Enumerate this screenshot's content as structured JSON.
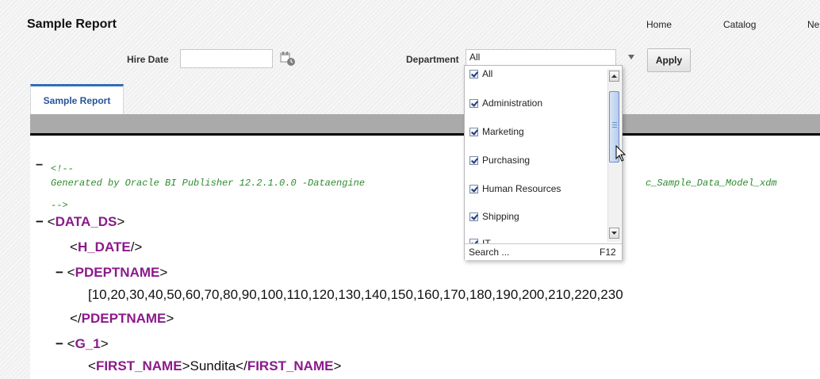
{
  "header": {
    "title": "Sample Report",
    "nav": [
      "Home",
      "Catalog",
      "Ne"
    ]
  },
  "params": {
    "hire_date_label": "Hire Date",
    "hire_date_value": "",
    "department_label": "Department",
    "department_value": "All",
    "apply_label": "Apply"
  },
  "tabs": [
    "Sample Report"
  ],
  "dropdown": {
    "options": [
      {
        "label": "All",
        "checked": true
      },
      {
        "label": "Administration",
        "checked": true
      },
      {
        "label": "Marketing",
        "checked": true
      },
      {
        "label": "Purchasing",
        "checked": true
      },
      {
        "label": "Human Resources",
        "checked": true
      },
      {
        "label": "Shipping",
        "checked": true
      },
      {
        "label": "IT",
        "checked": true
      }
    ],
    "search_label": "Search ...",
    "search_shortcut": "F12"
  },
  "xml": {
    "comment_open": "<!--",
    "comment_text": "Generated by Oracle BI Publisher 12.2.1.0.0 -Dataengine",
    "comment_tail": "c_Sample_Data_Model_xdm",
    "comment_close": "-->",
    "dash": "−",
    "lt": "<",
    "gt": ">",
    "close_lt": "</",
    "self_close": "/>",
    "data_ds": "DATA_DS",
    "h_date": "H_DATE",
    "pdeptname": "PDEPTNAME",
    "pdeptname_value": "[10,20,30,40,50,60,70,80,90,100,110,120,130,140,150,160,170,180,190,200,210,220,230",
    "g_1": "G_1",
    "first_name": "FIRST_NAME",
    "first_name_value": "Sundita"
  },
  "icons": {
    "calendar": "calendar-icon",
    "dropdown_arrow": "chevron-down-icon",
    "scroll_up": "scroll-up-icon",
    "scroll_down": "scroll-down-icon"
  }
}
